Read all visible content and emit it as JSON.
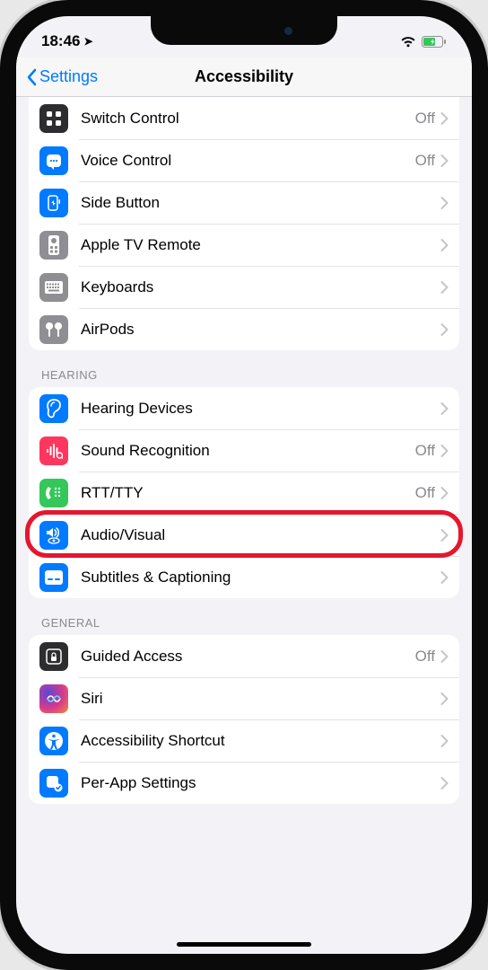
{
  "status": {
    "time": "18:46",
    "location_active": true
  },
  "nav": {
    "back_label": "Settings",
    "title": "Accessibility"
  },
  "sections": {
    "physical": {
      "items": [
        {
          "id": "switch-control",
          "label": "Switch Control",
          "value": "Off",
          "icon": "grid-icon",
          "bg": "bg-dark"
        },
        {
          "id": "voice-control",
          "label": "Voice Control",
          "value": "Off",
          "icon": "voice-icon",
          "bg": "bg-blue"
        },
        {
          "id": "side-button",
          "label": "Side Button",
          "value": "",
          "icon": "side-button-icon",
          "bg": "bg-blue"
        },
        {
          "id": "apple-tv-remote",
          "label": "Apple TV Remote",
          "value": "",
          "icon": "remote-icon",
          "bg": "bg-gray"
        },
        {
          "id": "keyboards",
          "label": "Keyboards",
          "value": "",
          "icon": "keyboard-icon",
          "bg": "bg-gray"
        },
        {
          "id": "airpods",
          "label": "AirPods",
          "value": "",
          "icon": "airpods-icon",
          "bg": "bg-gray"
        }
      ]
    },
    "hearing": {
      "header": "HEARING",
      "items": [
        {
          "id": "hearing-devices",
          "label": "Hearing Devices",
          "value": "",
          "icon": "ear-icon",
          "bg": "bg-blue"
        },
        {
          "id": "sound-recognition",
          "label": "Sound Recognition",
          "value": "Off",
          "icon": "waveform-icon",
          "bg": "bg-red"
        },
        {
          "id": "rtt-tty",
          "label": "RTT/TTY",
          "value": "Off",
          "icon": "tty-icon",
          "bg": "bg-green"
        },
        {
          "id": "audio-visual",
          "label": "Audio/Visual",
          "value": "",
          "icon": "speaker-eye-icon",
          "bg": "bg-blue",
          "highlighted": true
        },
        {
          "id": "subtitles-captioning",
          "label": "Subtitles & Captioning",
          "value": "",
          "icon": "caption-icon",
          "bg": "bg-blue"
        }
      ]
    },
    "general": {
      "header": "GENERAL",
      "items": [
        {
          "id": "guided-access",
          "label": "Guided Access",
          "value": "Off",
          "icon": "lock-icon",
          "bg": "bg-dark"
        },
        {
          "id": "siri",
          "label": "Siri",
          "value": "",
          "icon": "siri-icon",
          "bg": "bg-grad"
        },
        {
          "id": "accessibility-shortcut",
          "label": "Accessibility Shortcut",
          "value": "",
          "icon": "accessibility-icon",
          "bg": "bg-blue"
        },
        {
          "id": "per-app-settings",
          "label": "Per-App Settings",
          "value": "",
          "icon": "app-check-icon",
          "bg": "bg-blue"
        }
      ]
    }
  }
}
